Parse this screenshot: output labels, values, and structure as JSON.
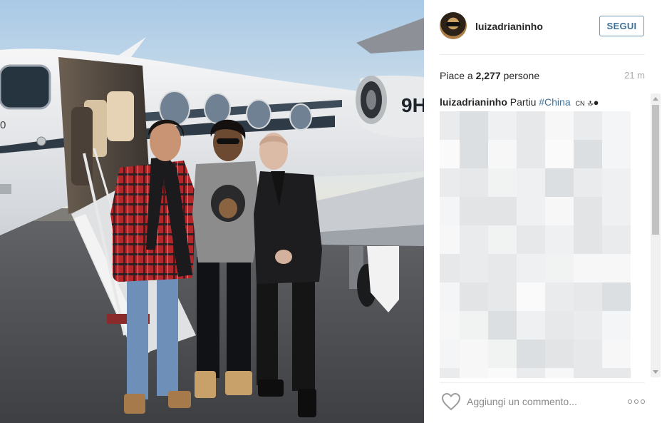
{
  "post": {
    "username": "luizadrianinho",
    "follow_label": "SEGUI",
    "likes_prefix": "Piace a",
    "likes_count": "2,277",
    "likes_suffix": "persone",
    "time_ago": "21 m"
  },
  "caption": {
    "username": "luizadrianinho",
    "text": "Partiu",
    "hashtag": "#China",
    "emoji": "CN"
  },
  "photo": {
    "plane_registration": "9H",
    "plane_model_fragment": "0"
  },
  "comment_box": {
    "placeholder": "Aggiungi un commento..."
  },
  "icons": {
    "heart": "heart-outline-icon",
    "more": "more-options-icon",
    "avatar": "avatar"
  }
}
